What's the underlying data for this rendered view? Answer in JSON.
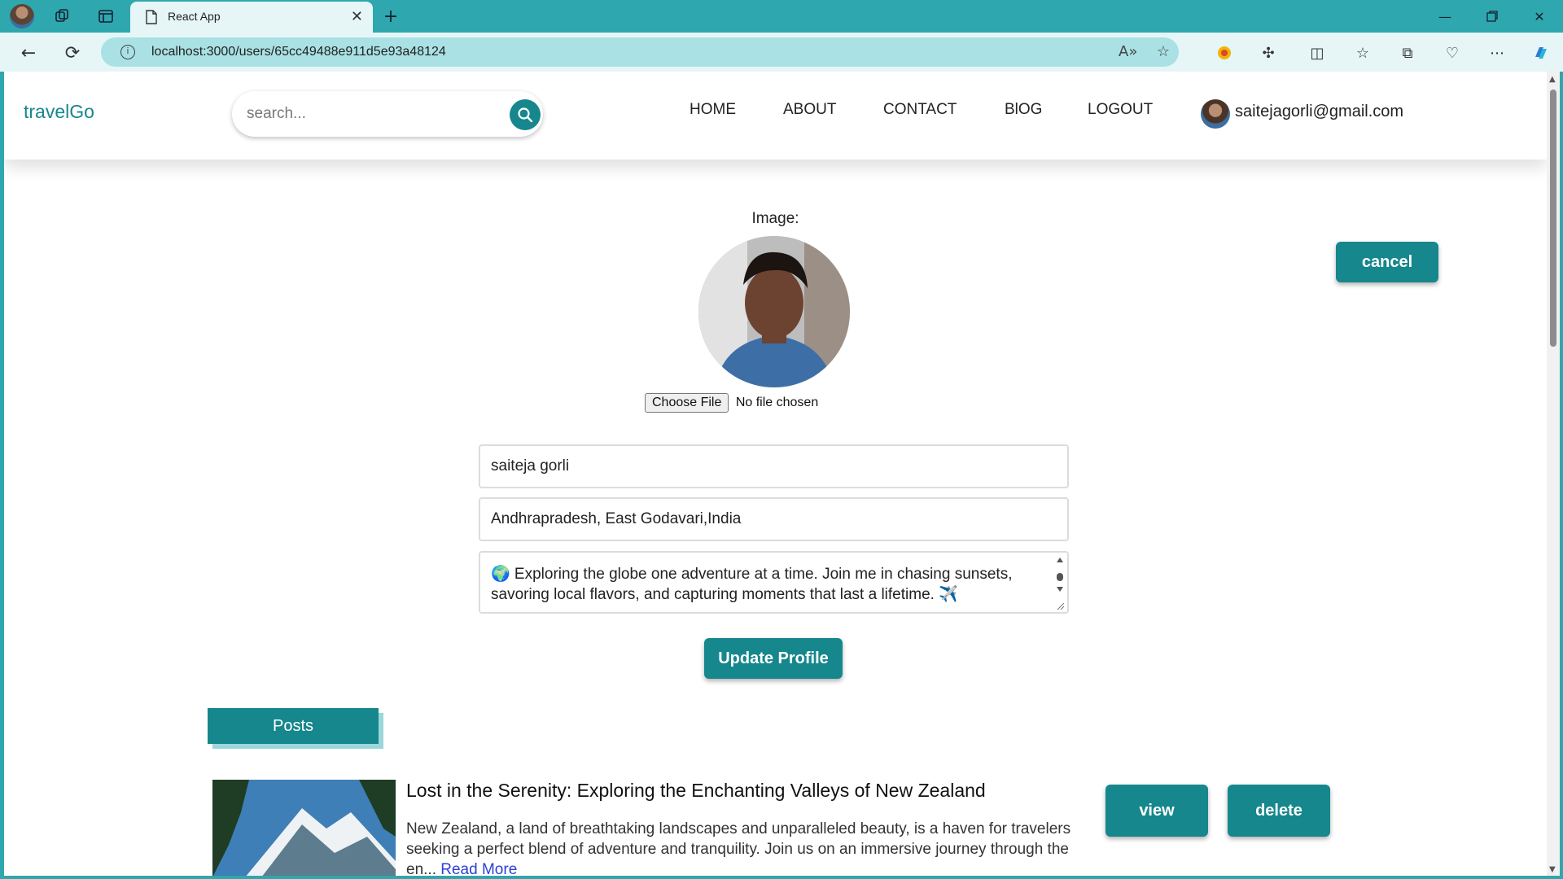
{
  "browser": {
    "tab_title": "React App",
    "url": "localhost:3000/users/65cc49488e911d5e93a48124"
  },
  "header": {
    "brand": "travelGo",
    "search_placeholder": "search...",
    "nav": [
      "HOME",
      "ABOUT",
      "CONTACT",
      "BlOG",
      "LOGOUT"
    ],
    "user_email": "saitejagorli@gmail.com"
  },
  "profile": {
    "image_label": "Image:",
    "choose_file_label": "Choose File",
    "no_file_text": "No file chosen",
    "cancel_label": "cancel",
    "name": "saiteja gorli",
    "location": "Andhrapradesh, East Godavari,India",
    "bio": "🌍 Exploring the globe one adventure at a time. Join me in chasing sunsets, savoring local flavors, and capturing moments that last a lifetime. ✈️",
    "update_label": "Update Profile"
  },
  "posts": {
    "tab_label": "Posts",
    "items": [
      {
        "title": "Lost in the Serenity: Exploring the Enchanting Valleys of New Zealand",
        "excerpt": "New Zealand, a land of breathtaking landscapes and unparalleled beauty, is a haven for travelers seeking a perfect blend of adventure and tranquility. Join us on an immersive journey through the en...",
        "read_more": "Read More",
        "view_label": "view",
        "delete_label": "delete"
      }
    ]
  },
  "colors": {
    "brand": "#15878d",
    "chrome": "#2fa7ae",
    "link": "#2b3fd8"
  }
}
